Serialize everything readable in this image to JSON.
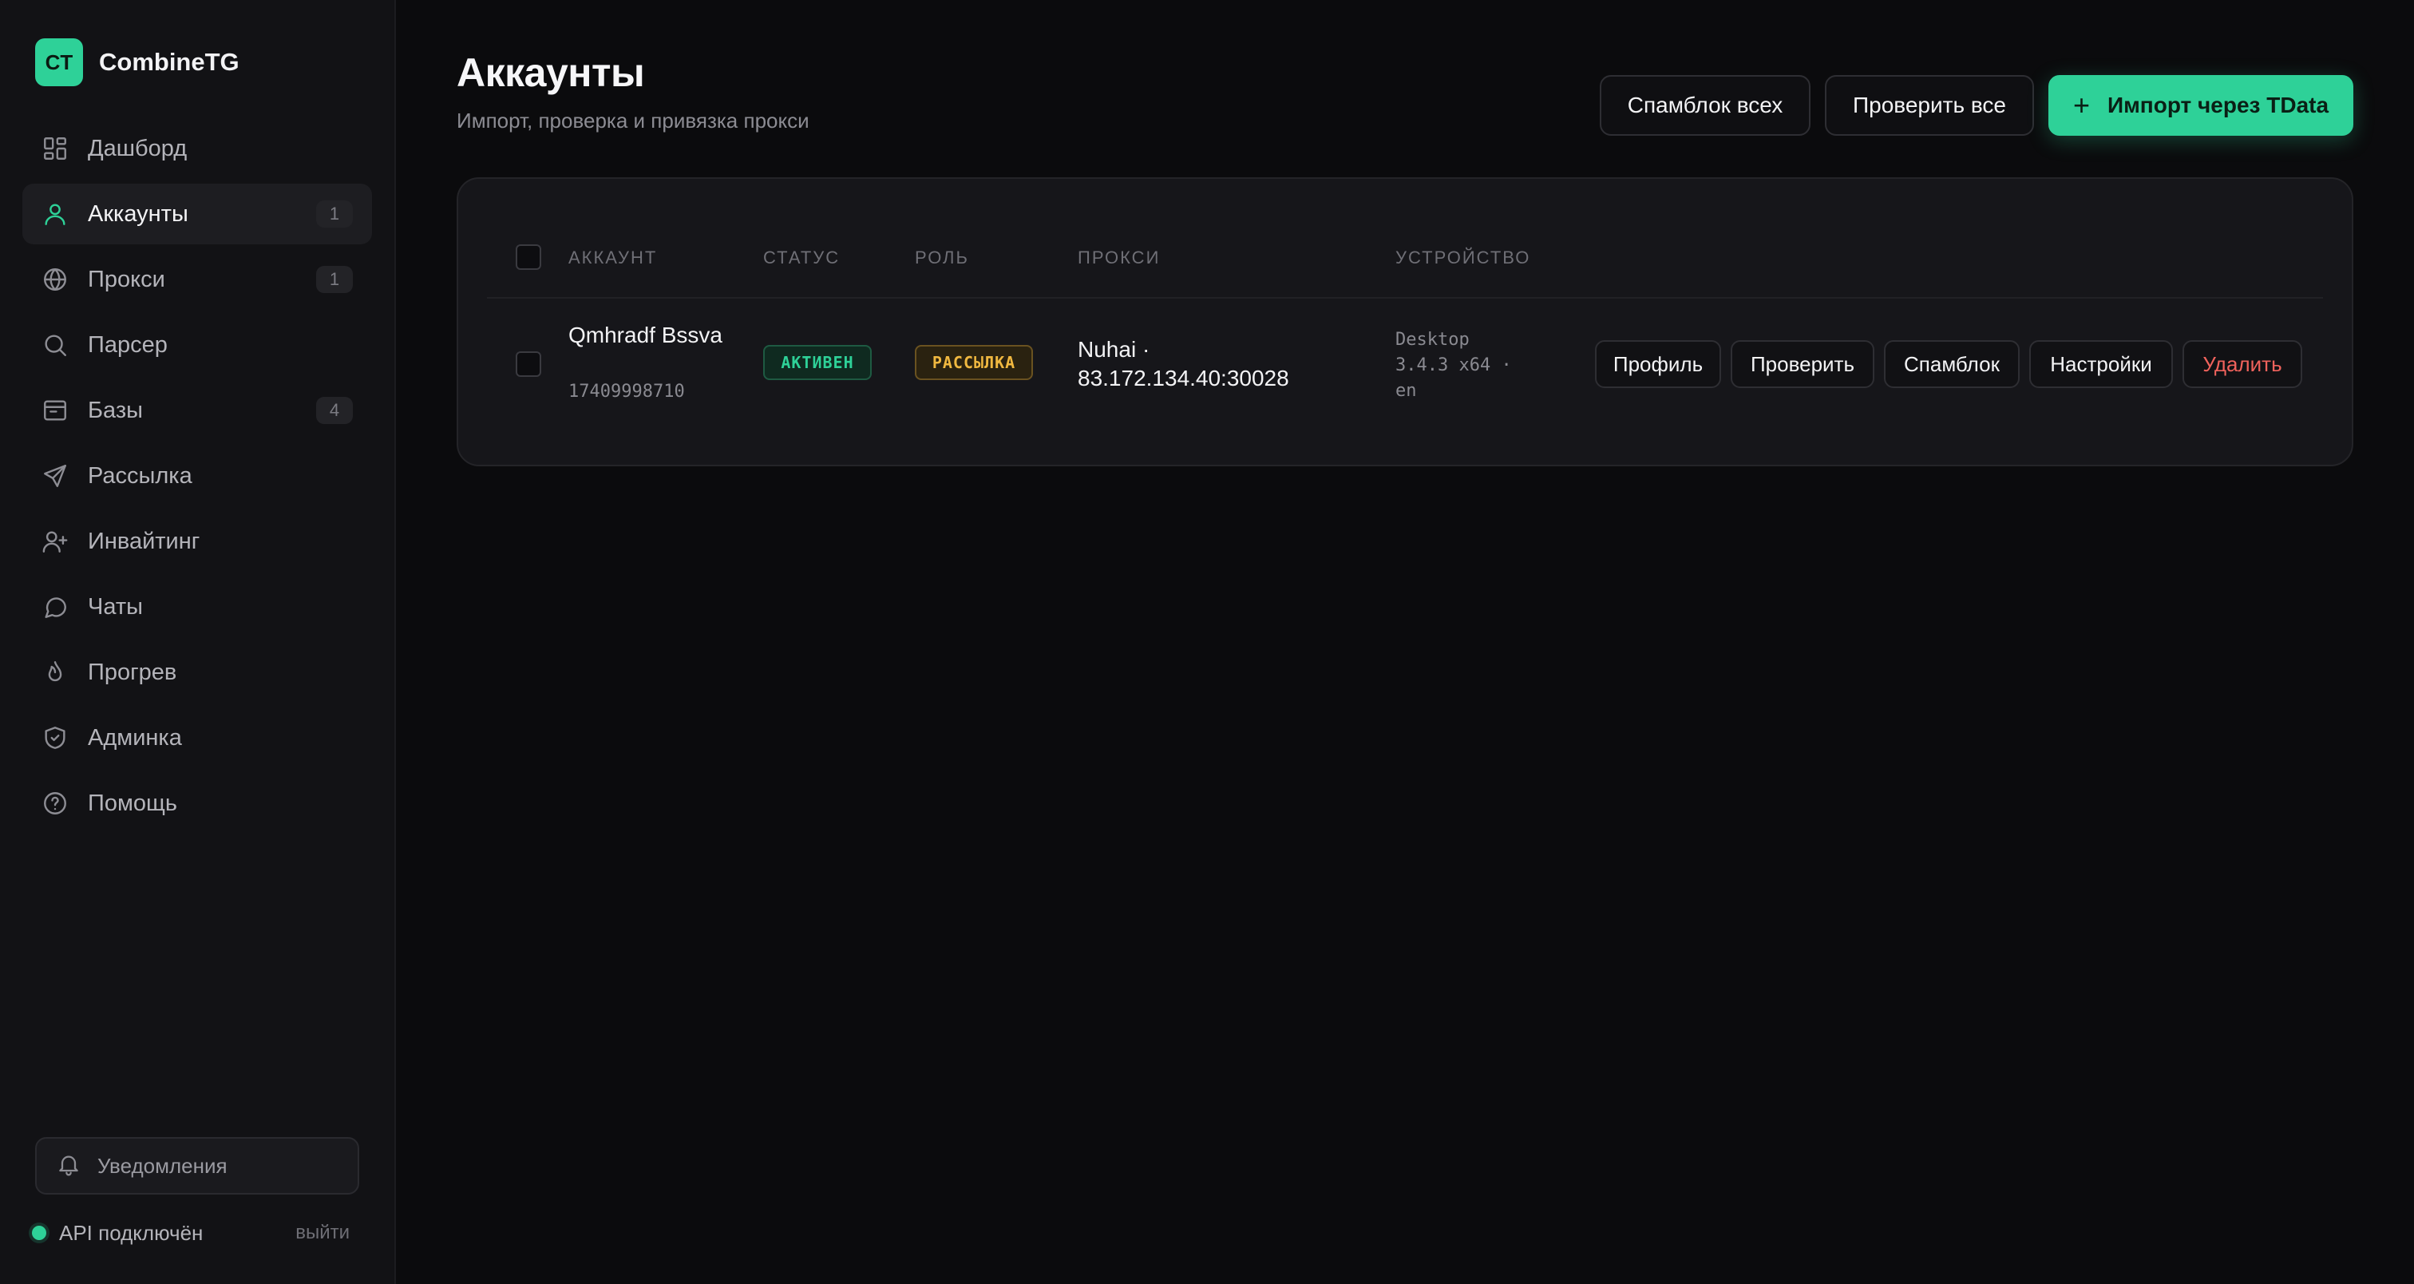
{
  "brand": {
    "logo_text": "CT",
    "name": "CombineTG"
  },
  "sidebar": {
    "items": [
      {
        "label": "Дашборд",
        "icon": "dashboard-icon",
        "count": ""
      },
      {
        "label": "Аккаунты",
        "icon": "user-icon",
        "count": "1"
      },
      {
        "label": "Прокси",
        "icon": "globe-icon",
        "count": "1"
      },
      {
        "label": "Парсер",
        "icon": "search-icon",
        "count": ""
      },
      {
        "label": "Базы",
        "icon": "archive-icon",
        "count": "4"
      },
      {
        "label": "Рассылка",
        "icon": "send-icon",
        "count": ""
      },
      {
        "label": "Инвайтинг",
        "icon": "user-plus-icon",
        "count": ""
      },
      {
        "label": "Чаты",
        "icon": "chat-icon",
        "count": ""
      },
      {
        "label": "Прогрев",
        "icon": "flame-icon",
        "count": ""
      },
      {
        "label": "Админка",
        "icon": "shield-icon",
        "count": ""
      },
      {
        "label": "Помощь",
        "icon": "help-icon",
        "count": ""
      }
    ],
    "active_index": 1,
    "notifications_label": "Уведомления",
    "api_status": "API подключён",
    "logout": "выйти"
  },
  "header": {
    "title": "Аккаунты",
    "subtitle": "Импорт, проверка и привязка прокси",
    "spamblock_all": "Спамблок всех",
    "check_all": "Проверить все",
    "import_plus": "+",
    "import_label": "Импорт через TData"
  },
  "table": {
    "columns": {
      "account": "АККАУНТ",
      "status": "СТАТУС",
      "role": "РОЛЬ",
      "proxy": "ПРОКСИ",
      "device": "УСТРОЙСТВО"
    },
    "rows": [
      {
        "name": "Qmhradf Bssva",
        "id": "17409998710",
        "status": "АКТИВЕН",
        "role": "РАССЫЛКА",
        "proxy": "Nuhai · 83.172.134.40:30028",
        "device": "Desktop 3.4.3 x64 · en",
        "actions": {
          "profile": "Профиль",
          "check": "Проверить",
          "spamblock": "Спамблок",
          "settings": "Настройки",
          "delete": "Удалить"
        }
      }
    ]
  },
  "colors": {
    "accent": "#2ed198",
    "danger": "#f0625c",
    "role_badge": "#f0b840",
    "background": "#0b0b0d"
  }
}
